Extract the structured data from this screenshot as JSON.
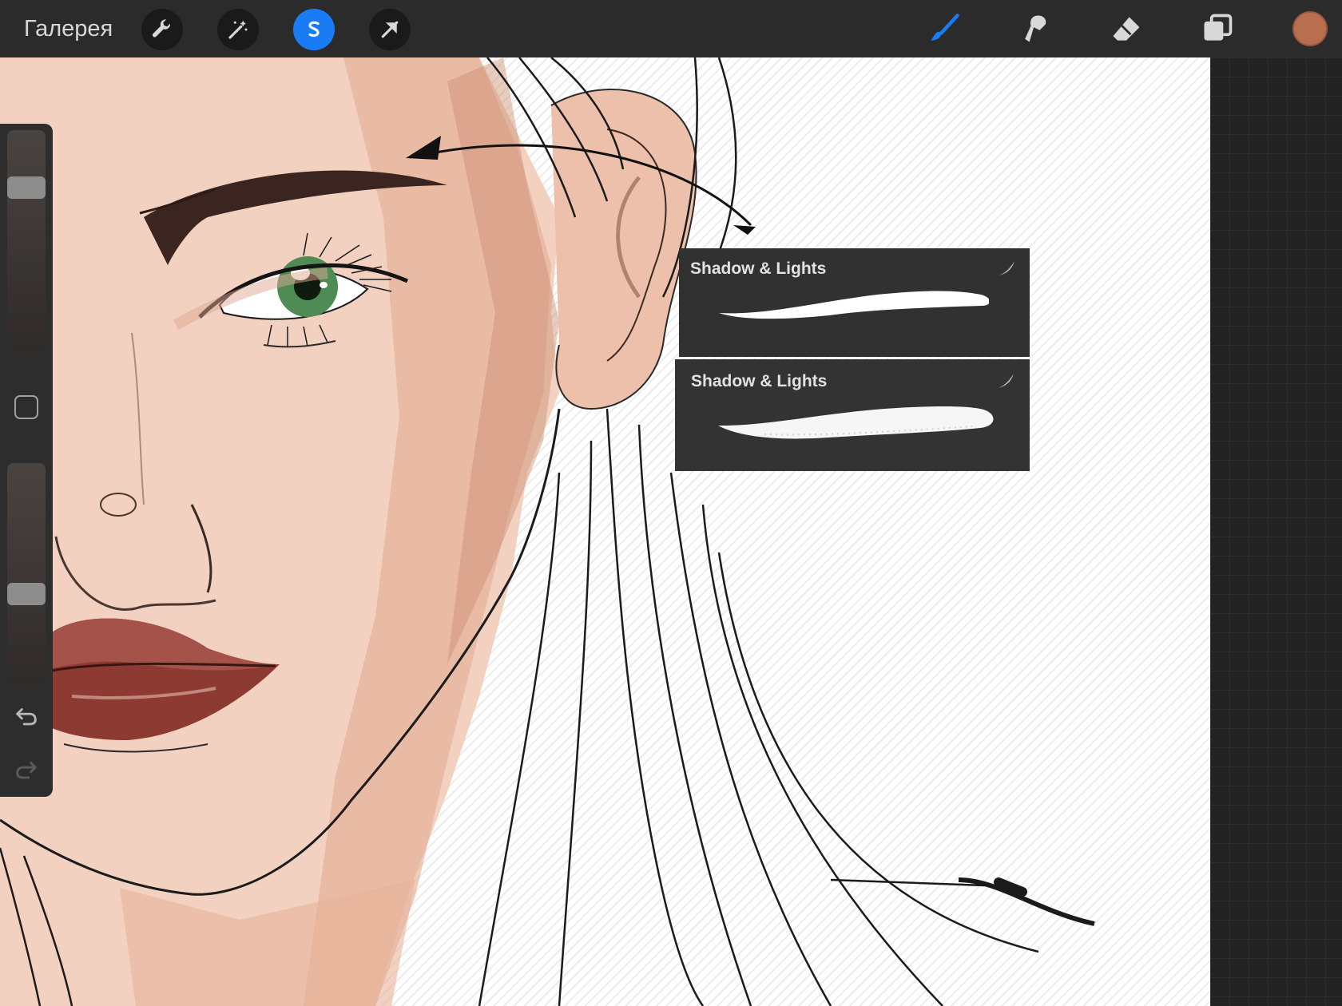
{
  "toolbar": {
    "gallery_label": "Галерея",
    "tools": [
      "wrench-icon",
      "magic-wand-icon",
      "selection-icon",
      "move-arrow-icon"
    ],
    "active_tool": "selection-icon",
    "right_tools": [
      "brush-icon",
      "smudge-icon",
      "eraser-icon",
      "layers-icon"
    ],
    "active_right_tool": "brush-icon",
    "color": "#b86e4f"
  },
  "brush_popup": {
    "items": [
      {
        "name": "Shadow & Lights",
        "icon": "brush-preview-icon"
      },
      {
        "name": "Shadow & Lights",
        "icon": "brush-preview-icon"
      }
    ]
  },
  "sidebar": {
    "size_slider_level": 0.25,
    "opacity_slider_level": 0.6,
    "buttons": [
      "modifier-button",
      "undo-icon",
      "redo-icon"
    ]
  },
  "colors": {
    "accent": "#1a7cf5",
    "toolbar_bg": "#2b2b2b",
    "skin": "#f3d3c2"
  }
}
